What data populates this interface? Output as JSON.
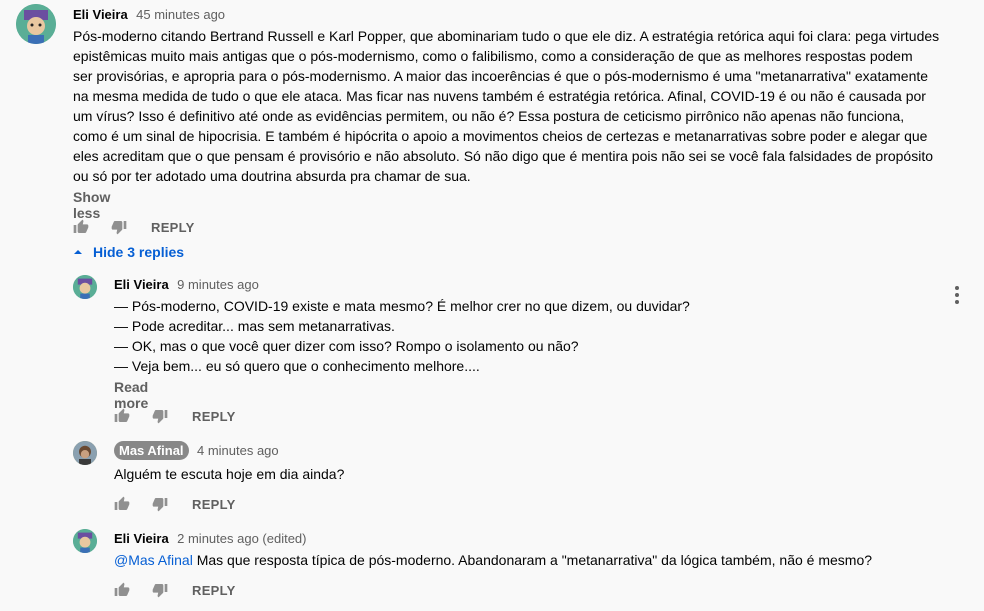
{
  "main_comment": {
    "author": "Eli Vieira",
    "time": "45 minutes ago",
    "lines": [
      "Pós-moderno citando Bertrand Russell e Karl Popper, que abominariam tudo o que ele diz. A estratégia retórica aqui foi clara: pega virtudes",
      "epistêmicas muito mais antigas que o pós-modernismo, como o falibilismo, como a consideração de que as melhores respostas podem",
      "ser provisórias, e apropria para o pós-modernismo. A maior das incoerências é que o pós-modernismo é uma \"metanarrativa\" exatamente",
      "na mesma medida de tudo o que ele ataca. Mas ficar nas nuvens também é estratégia retórica. Afinal, COVID-19 é ou não é causada por",
      "um vírus? Isso é definitivo até onde as evidências permitem, ou não é? Essa postura de ceticismo pirrônico não apenas não funciona,",
      "como é um sinal de hipocrisia. E também é hipócrita o apoio a movimentos cheios de certezas e metanarrativas sobre poder e alegar que",
      "eles acreditam que o que pensam é provisório e não absoluto. Só não digo que é mentira pois não sei se você fala falsidades de propósito",
      "ou só por ter adotado uma doutrina absurda pra chamar de sua."
    ],
    "show_less": "Show less",
    "reply_label": "REPLY"
  },
  "hide_replies_label": "Hide 3 replies",
  "replies": [
    {
      "author": "Eli Vieira",
      "time": "9 minutes ago",
      "lines": [
        "— Pós-moderno, COVID-19 existe e mata mesmo? É melhor crer no que dizem, ou duvidar?",
        "— Pode acreditar... mas sem metanarrativas.",
        "—  OK, mas o que você quer dizer com isso? Rompo o isolamento ou não?",
        "— Veja bem... eu só quero que o conhecimento melhore...."
      ],
      "read_more": "Read more",
      "reply_label": "REPLY"
    },
    {
      "author": "Mas Afinal",
      "time": "4 minutes ago",
      "text": "Alguém te escuta hoje em dia ainda?",
      "reply_label": "REPLY"
    },
    {
      "author": "Eli Vieira",
      "time": "2 minutes ago (edited)",
      "mention": "@Mas Afinal",
      "text": " Mas que resposta típica de pós-moderno. Abandonaram a \"metanarrativa\" da lógica também, não é mesmo?",
      "reply_label": "REPLY"
    }
  ],
  "colors": {
    "background": "#f9f9f9",
    "link_blue": "#065fd4",
    "secondary_text": "#606060",
    "badge_gray": "#888888"
  },
  "icons": [
    "like-icon",
    "dislike-icon",
    "chevron-up-icon",
    "more-vert-icon",
    "avatar-icon"
  ]
}
